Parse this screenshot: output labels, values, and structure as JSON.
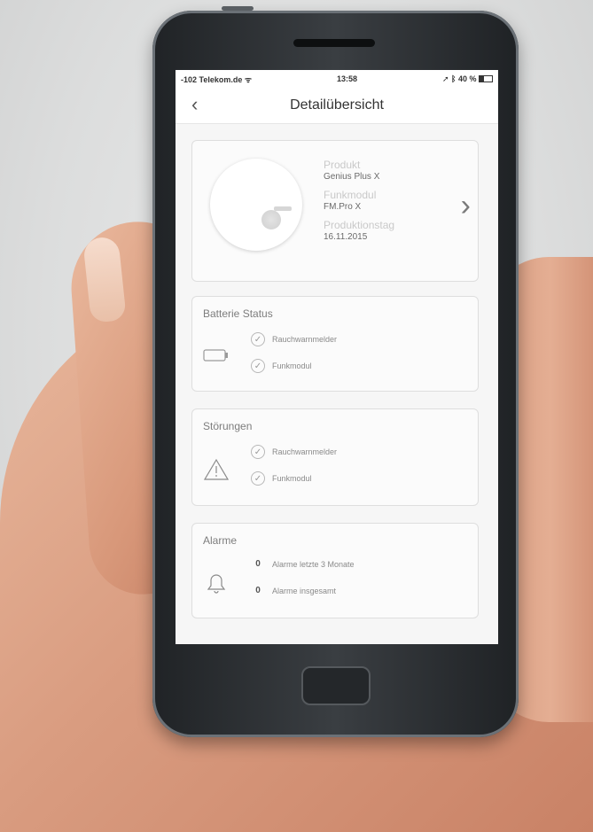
{
  "status_bar": {
    "carrier": "-102 Telekom.de",
    "time": "13:58",
    "battery": "40 %"
  },
  "nav": {
    "title": "Detailübersicht"
  },
  "product": {
    "labels": [
      "Produkt",
      "Funkmodul",
      "Produktionstag"
    ],
    "values": [
      "Genius Plus X",
      "FM.Pro X",
      "16.11.2015"
    ]
  },
  "battery_status": {
    "title": "Batterie Status",
    "items": [
      "Rauchwarnmelder",
      "Funkmodul"
    ]
  },
  "stoerungen": {
    "title": "Störungen",
    "items": [
      "Rauchwarnmelder",
      "Funkmodul"
    ]
  },
  "alarme": {
    "title": "Alarme",
    "items": [
      {
        "count": "0",
        "label": "Alarme letzte 3 Monate"
      },
      {
        "count": "0",
        "label": "Alarme insgesamt"
      }
    ]
  }
}
